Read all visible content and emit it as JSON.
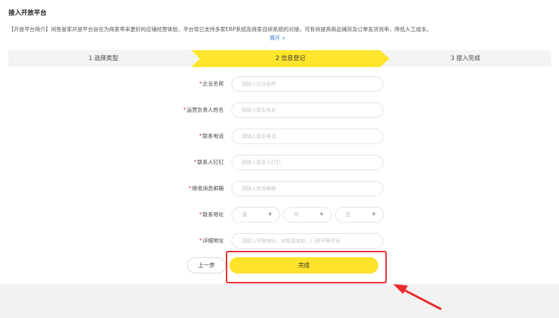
{
  "header": {
    "title": "接入开放平台",
    "intro": "【开放平台简介】闲鱼管家开放平台旨在为商家带来更好的店铺经营体验，平台现已支持多家ERP系统及商家自研系统的对接，可有效提高商品铺货及订单发货效率，降低人工成本。",
    "expand_label": "展开"
  },
  "steps": [
    {
      "label": "1 选择类型",
      "active": false
    },
    {
      "label": "2 信息登记",
      "active": true
    },
    {
      "label": "3 接入完成",
      "active": false
    }
  ],
  "form": {
    "required_mark": "*",
    "company_name": {
      "label": "企业名称",
      "placeholder": "请输入企业名称"
    },
    "operator_name": {
      "label": "运营负责人姓名",
      "placeholder": "请输入真实姓名"
    },
    "phone": {
      "label": "联系电话",
      "placeholder": "请输入联系电话"
    },
    "dingtalk": {
      "label": "联系人钉钉",
      "placeholder": "请输入联系人钉钉"
    },
    "email": {
      "label": "接收消息邮箱",
      "placeholder": "请输入有效邮箱"
    },
    "address": {
      "label": "联系地址",
      "province": "省",
      "city": "市",
      "district": "区"
    },
    "detail_address": {
      "label": "详细地址",
      "placeholder": "请输入详细地址，如街道名称、门牌号等信息"
    }
  },
  "actions": {
    "prev_label": "上一步",
    "finish_label": "完成"
  },
  "colors": {
    "accent_yellow": "#ffe22a",
    "annotation_red": "#ea2a2a",
    "link_blue": "#4a7fd6"
  }
}
